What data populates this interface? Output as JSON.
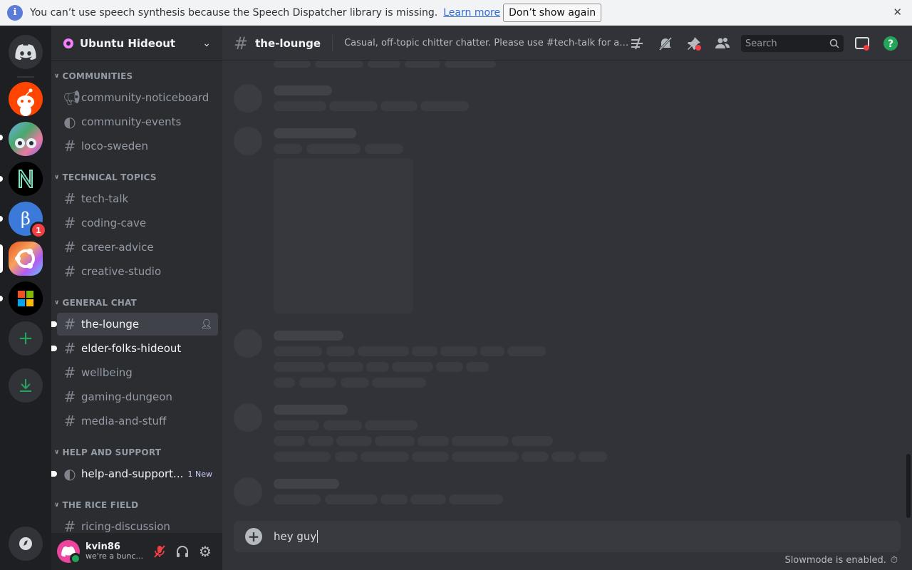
{
  "notice": {
    "message": "You can’t use speech synthesis because the Speech Dispatcher library is missing.",
    "learn_more": "Learn more",
    "dont_show": "Don’t show again"
  },
  "server": {
    "name": "Ubuntu Hideout"
  },
  "rail": {
    "badge_count": "1"
  },
  "categories": {
    "communities": "COMMUNITIES",
    "technical": "TECHNICAL TOPICS",
    "general": "GENERAL CHAT",
    "help": "HELP AND SUPPORT",
    "rice": "THE RICE FIELD"
  },
  "channels": {
    "community_noticeboard": "community-noticeboard",
    "community_events": "community-events",
    "loco_sweden": "loco-sweden",
    "tech_talk": "tech-talk",
    "coding_cave": "coding-cave",
    "career_advice": "career-advice",
    "creative_studio": "creative-studio",
    "the_lounge": "the-lounge",
    "elder_folks": "elder-folks-hideout",
    "wellbeing": "wellbeing",
    "gaming_dungeon": "gaming-dungeon",
    "media_and_stuff": "media-and-stuff",
    "help_and_support": "help-and-support...",
    "help_new": "1 New",
    "ricing": "ricing-discussion"
  },
  "user": {
    "name": "kvin86",
    "status": "we're a bunc..."
  },
  "header": {
    "channel": "the-lounge",
    "topic": "Casual, off-topic chitter chatter. Please use #tech-talk for actual...",
    "search_placeholder": "Search"
  },
  "composer": {
    "text": "hey guy"
  },
  "footer": {
    "slowmode": "Slowmode is enabled."
  },
  "colors": {
    "accent": "#5865f2",
    "green": "#23a55a",
    "red": "#f23f43"
  }
}
